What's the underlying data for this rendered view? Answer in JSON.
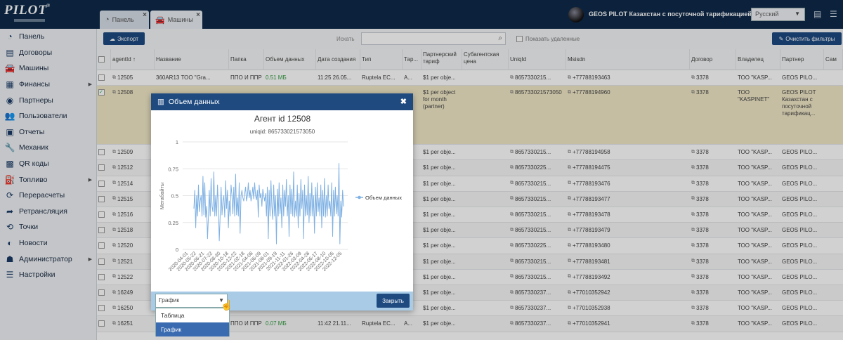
{
  "topbar": {
    "logo": "PILOT",
    "tabs": [
      {
        "label": "Панель"
      },
      {
        "label": "Машины"
      }
    ],
    "account": "GEOS PILOT Казахстан с посуточной тарификацией",
    "language": "Русский"
  },
  "sidebar": {
    "items": [
      {
        "label": "Панель",
        "icon": "dashboard-icon",
        "sub": false
      },
      {
        "label": "Договоры",
        "icon": "contract-icon",
        "sub": false
      },
      {
        "label": "Машины",
        "icon": "car-icon",
        "sub": false
      },
      {
        "label": "Финансы",
        "icon": "money-icon",
        "sub": true
      },
      {
        "label": "Партнеры",
        "icon": "partner-icon",
        "sub": false
      },
      {
        "label": "Пользователи",
        "icon": "users-icon",
        "sub": false
      },
      {
        "label": "Отчеты",
        "icon": "report-icon",
        "sub": false
      },
      {
        "label": "Механик",
        "icon": "wrench-icon",
        "sub": false
      },
      {
        "label": "QR коды",
        "icon": "qr-icon",
        "sub": false
      },
      {
        "label": "Топливо",
        "icon": "fuel-icon",
        "sub": true
      },
      {
        "label": "Перерасчеты",
        "icon": "recalc-icon",
        "sub": false
      },
      {
        "label": "Ретрансляция",
        "icon": "share-icon",
        "sub": false
      },
      {
        "label": "Точки",
        "icon": "history-icon",
        "sub": false
      },
      {
        "label": "Новости",
        "icon": "news-icon",
        "sub": false
      },
      {
        "label": "Администратор",
        "icon": "admin-icon",
        "sub": true
      },
      {
        "label": "Настройки",
        "icon": "settings-icon",
        "sub": false
      }
    ]
  },
  "toolbar": {
    "export_label": "Экспорт",
    "search_label": "Искать",
    "search_value": "",
    "show_deleted_label": "Показать удаленные",
    "clear_filters_label": "Очистить фильтры"
  },
  "table": {
    "headers": [
      "",
      "agentId ↑",
      "Название",
      "Папка",
      "Объем данных",
      "Дата создания",
      "Тип",
      "Тар...",
      "Партнерский тариф",
      "Субагентская цена",
      "UniqId",
      "Msisdn",
      "Договор",
      "Владелец",
      "Партнер",
      "Сам"
    ],
    "rows": [
      {
        "id": "12505",
        "name": "360AR13 ТОО \"Gra...",
        "folder": "ППО И ППР",
        "vol": "0.51 МБ",
        "date": "11:25 26.05...",
        "type": "Ruptela EC...",
        "tar": "A...",
        "ptar": "$1 per obje...",
        "uniq": "8657330215...",
        "msisdn": "+77788193463",
        "contract": "3378",
        "owner": "ТОО \"KASP...",
        "partner": "GEOS PILO..."
      },
      {
        "id": "12508",
        "name": "",
        "folder": "",
        "vol": "",
        "date": "",
        "type": "",
        "tar": "",
        "ptar": "$1 per object for month (partner)",
        "uniq": "865733021573050",
        "msisdn": "+77788194960",
        "contract": "3378",
        "owner": "ТОО \"KASPINET\"",
        "partner": "GEOS PILOT Казахстан с посуточной тарификац..."
      },
      {
        "id": "12509",
        "ptar": "$1 per obje...",
        "uniq": "8657330215...",
        "msisdn": "+77788194958",
        "contract": "3378",
        "owner": "ТОО \"KASP...",
        "partner": "GEOS PILO..."
      },
      {
        "id": "12512",
        "ptar": "$1 per obje...",
        "uniq": "8657330225...",
        "msisdn": "+77788194475",
        "contract": "3378",
        "owner": "ТОО \"KASP...",
        "partner": "GEOS PILO..."
      },
      {
        "id": "12514",
        "ptar": "$1 per obje...",
        "uniq": "8657330215...",
        "msisdn": "+77788193476",
        "contract": "3378",
        "owner": "ТОО \"KASP...",
        "partner": "GEOS PILO..."
      },
      {
        "id": "12515",
        "ptar": "$1 per obje...",
        "uniq": "8657330215...",
        "msisdn": "+77788193477",
        "contract": "3378",
        "owner": "ТОО \"KASP...",
        "partner": "GEOS PILO..."
      },
      {
        "id": "12516",
        "ptar": "$1 per obje...",
        "uniq": "8657330215...",
        "msisdn": "+77788193478",
        "contract": "3378",
        "owner": "ТОО \"KASP...",
        "partner": "GEOS PILO..."
      },
      {
        "id": "12518",
        "ptar": "$1 per obje...",
        "uniq": "8657330215...",
        "msisdn": "+77788193479",
        "contract": "3378",
        "owner": "ТОО \"KASP...",
        "partner": "GEOS PILO..."
      },
      {
        "id": "12520",
        "ptar": "$1 per obje...",
        "uniq": "8657330225...",
        "msisdn": "+77788193480",
        "contract": "3378",
        "owner": "ТОО \"KASP...",
        "partner": "GEOS PILO..."
      },
      {
        "id": "12521",
        "ptar": "$1 per obje...",
        "uniq": "8657330215...",
        "msisdn": "+77788193481",
        "contract": "3378",
        "owner": "ТОО \"KASP...",
        "partner": "GEOS PILO..."
      },
      {
        "id": "12522",
        "ptar": "$1 per obje...",
        "uniq": "8657330215...",
        "msisdn": "+77788193492",
        "contract": "3378",
        "owner": "ТОО \"KASP...",
        "partner": "GEOS PILO..."
      },
      {
        "id": "16249",
        "ptar": "$1 per obje...",
        "uniq": "8657330237...",
        "msisdn": "+77010352942",
        "contract": "3378",
        "owner": "ТОО \"KASP...",
        "partner": "GEOS PILO..."
      },
      {
        "id": "16250",
        "ptar": "$1 per obje...",
        "uniq": "8657330237...",
        "msisdn": "+77010352938",
        "contract": "3378",
        "owner": "ТОО \"KASP...",
        "partner": "GEOS PILO..."
      },
      {
        "id": "16251",
        "folder": "ППО И ППР",
        "vol": "0.07 МБ",
        "date": "11:42 21.11...",
        "type": "Ruptela EC...",
        "tar": "A...",
        "ptar": "$1 per obje...",
        "uniq": "8657330237...",
        "msisdn": "+77010352941",
        "contract": "3378",
        "owner": "ТОО \"KASP...",
        "partner": "GEOS PILO..."
      }
    ]
  },
  "modal": {
    "title": "Объем данных",
    "chart_title": "Агент id 12508",
    "chart_subtitle": "uniqid: 865733021573050",
    "legend": "Объем данных",
    "ylabel": "Мегабайты",
    "view_value": "График",
    "options": [
      "Таблица",
      "График"
    ],
    "close_label": "Закрыть"
  },
  "chart_data": {
    "type": "line",
    "title": "Агент id 12508",
    "subtitle": "uniqid: 865733021573050",
    "xlabel": "",
    "ylabel": "Мегабайты",
    "ylim": [
      0,
      1
    ],
    "yticks": [
      0,
      0.25,
      0.5,
      0.75,
      1
    ],
    "xticks": [
      "2020-04-01",
      "2020-05-22",
      "2020-06-21",
      "2020-07-22",
      "2020-08-30",
      "2020-10-18",
      "2020-12-22",
      "2021-02-18",
      "2021-04-08",
      "2021-06-09",
      "2021-08-01",
      "2021-09-19",
      "2021-11-11",
      "2022-01-26",
      "2022-03-09",
      "2022-04-28",
      "2022-06-17",
      "2022-08-10",
      "2022-10-05",
      "2022-12-05"
    ],
    "legend_position": "right",
    "series": [
      {
        "name": "Объем данных",
        "color": "#7fb1e3",
        "values": [
          0.38,
          0.55,
          0.2,
          0.5,
          0.31,
          0.6,
          0.35,
          0.45,
          0.5,
          0.31,
          0.68,
          0.32,
          0.62,
          0.3,
          0.4,
          0.1,
          0.31,
          0.55,
          0.31,
          0.66,
          0.4,
          0.35,
          0.72,
          0.31,
          0.5,
          0.31,
          0.6,
          0.4,
          0.08,
          0.31,
          0.58,
          0.32,
          0.45,
          0.5,
          0.3,
          0.64,
          0.38,
          0.55,
          0.2,
          0.45,
          0.31,
          0.6,
          0.5,
          0.33,
          0.58,
          0.31,
          0.7,
          0.32,
          0.48,
          0.31,
          0.62,
          0.15,
          0.5,
          0.55,
          0.48,
          0.45,
          0.52,
          0.58,
          0.45,
          0.5,
          0.62,
          0.48,
          0.55,
          0.45,
          0.5,
          0.58,
          0.47,
          0.62,
          0.5,
          0.46,
          0.55,
          0.3,
          0.6,
          0.48,
          0.52,
          0.4,
          0.56,
          0.5,
          0.45,
          0.52,
          0.31,
          0.58,
          0.1,
          0.55,
          0.31,
          0.64,
          0.4,
          0.28,
          0.6,
          0.31,
          0.5,
          0.05,
          0.56,
          0.31,
          0.62,
          0.33,
          0.48,
          0.2,
          0.6,
          0.31,
          0.55,
          0.4,
          0.65,
          0.31,
          0.5,
          0.12,
          0.6,
          0.33,
          0.56,
          0.31,
          0.72,
          0.3,
          0.45,
          0.31,
          0.6,
          0.2,
          0.52,
          0.31,
          0.65,
          0.38,
          0.55,
          0.1,
          0.6,
          0.31,
          0.5,
          0.32,
          0.68,
          0.25,
          0.52,
          0.31,
          0.62,
          0.31,
          0.5,
          0.15,
          0.58,
          0.31,
          0.62,
          0.35,
          0.48,
          0.31,
          0.6,
          0.2,
          0.55,
          0.31,
          0.66,
          0.3,
          0.5,
          0.31,
          0.6,
          0.38,
          0.45,
          0.31,
          0.62,
          0.12,
          0.55,
          0.31,
          0.58,
          0.33,
          0.5,
          0.31,
          0.8,
          0.05,
          0.45,
          0.3,
          0.55,
          0.4
        ]
      }
    ]
  }
}
